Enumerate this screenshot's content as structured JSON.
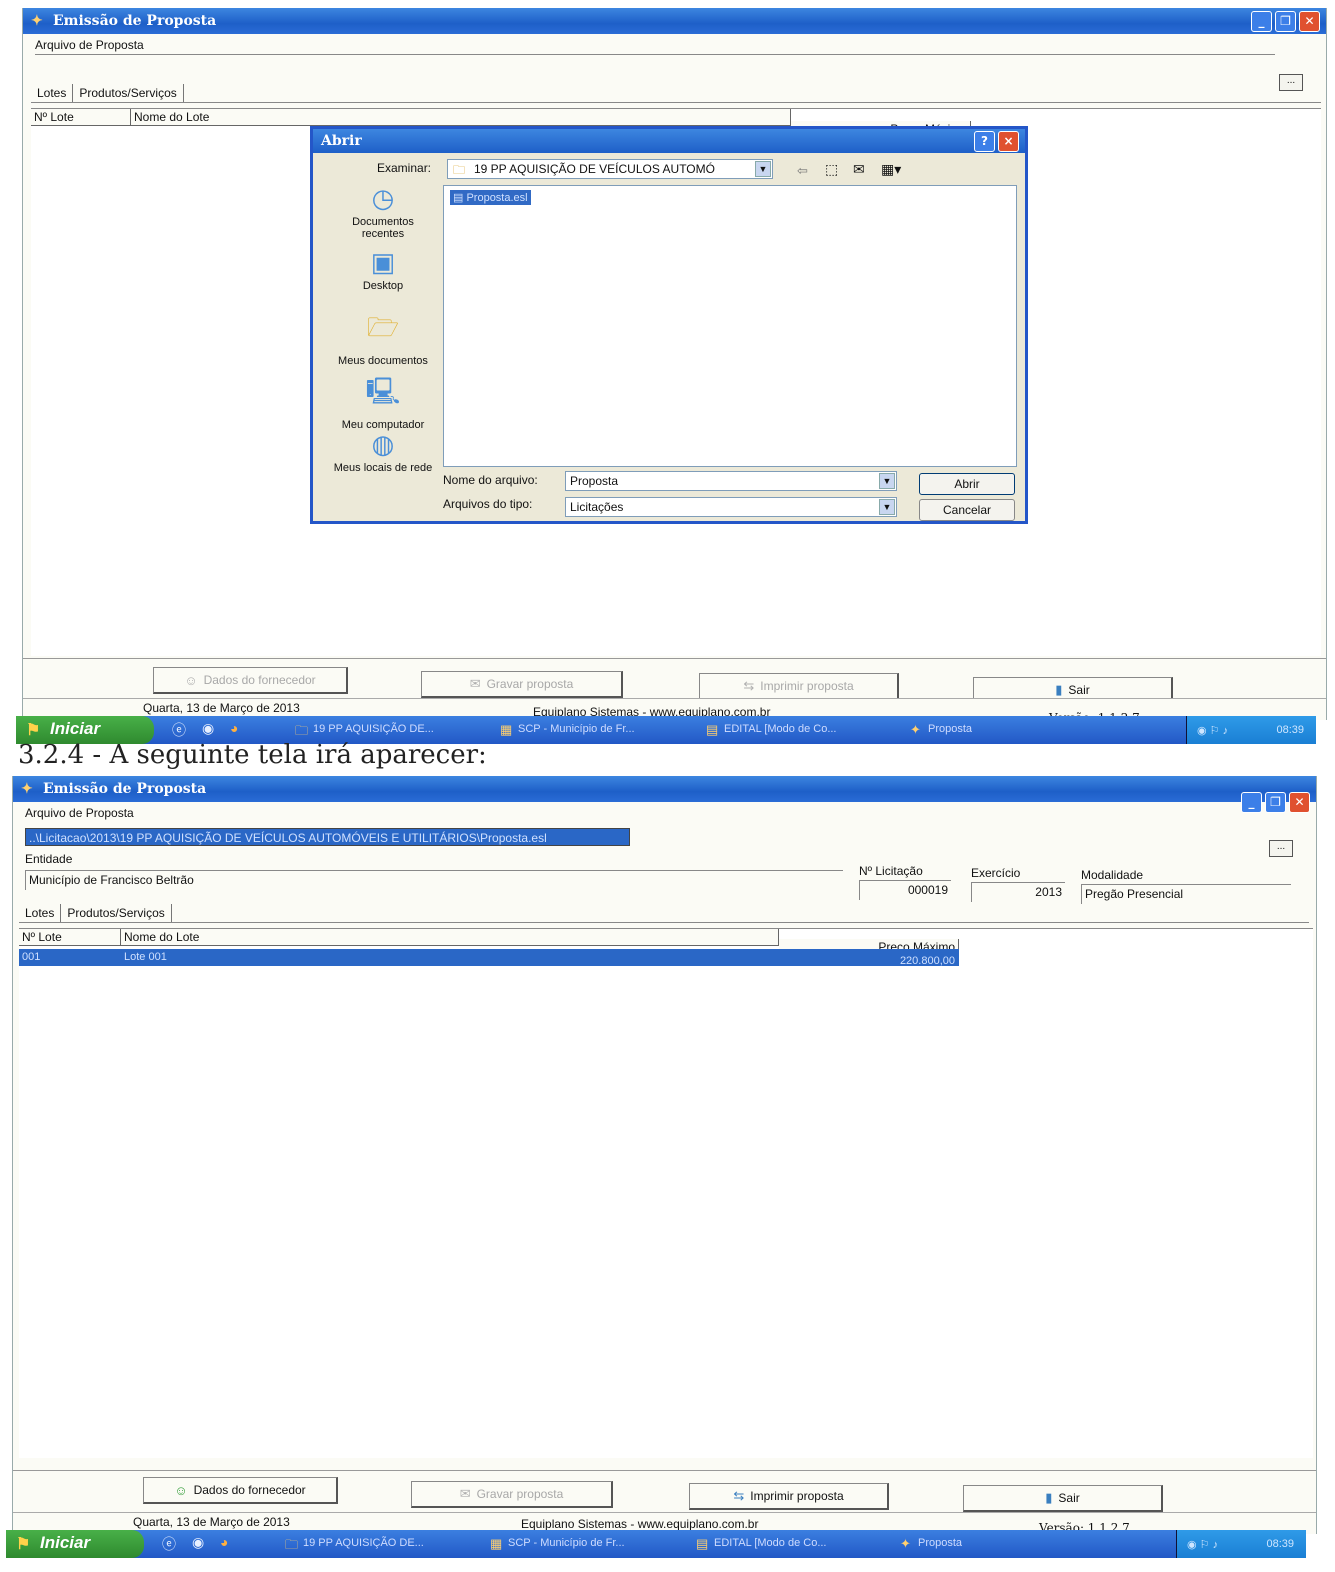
{
  "shot1": {
    "window": {
      "title": "Emissão de Proposta"
    },
    "arquivo": {
      "label": "Arquivo de Proposta",
      "value": "",
      "browse_label": "..."
    },
    "tabs": [
      "Lotes",
      "Produtos/Serviços"
    ],
    "grid": {
      "col_num": "Nº Lote",
      "col_name": "Nome do Lote",
      "col_price": "Preço Máximo"
    },
    "dialog": {
      "title": "Abrir",
      "look_in_label": "Examinar:",
      "look_in_value": "19 PP AQUISIÇÃO DE VEÍCULOS AUTOMÓ",
      "places": [
        "Documentos recentes",
        "Desktop",
        "Meus documentos",
        "Meu computador",
        "Meus locais de rede"
      ],
      "file_item": "Proposta.esl",
      "filename_label": "Nome do arquivo:",
      "filename_value": "Proposta",
      "filetype_label": "Arquivos do tipo:",
      "filetype_value": "Licitações",
      "open_label": "Abrir",
      "cancel_label": "Cancelar",
      "help_label": "?",
      "close_label": "×"
    },
    "buttons": {
      "fornecedor": "Dados do fornecedor",
      "gravar": "Gravar proposta",
      "imprimir": "Imprimir proposta",
      "sair": "Sair"
    },
    "status": {
      "date": "Quarta, 13 de Março de 2013",
      "company": "Equiplano Sistemas - www.equiplano.com.br",
      "version": "Versão: 1.1.2.7"
    },
    "taskbar": {
      "start": "Iniciar",
      "tasks": [
        "19 PP AQUISIÇÃO DE...",
        "SCP - Município de Fr...",
        "EDITAL [Modo de Co...",
        "Proposta"
      ],
      "clock": "08:39"
    }
  },
  "caption": "3.2.4 - A seguinte tela irá aparecer:",
  "shot2": {
    "window": {
      "title": "Emissão de Proposta"
    },
    "arquivo": {
      "label": "Arquivo de Proposta",
      "value": "..\\Licitacao\\2013\\19 PP AQUISIÇÃO DE VEÍCULOS AUTOMÓVEIS E UTILITÁRIOS\\Proposta.esl",
      "browse_label": "..."
    },
    "entidade": {
      "label": "Entidade",
      "value": "Município de Francisco Beltrão"
    },
    "licitacao": {
      "label": "Nº Licitação",
      "value": "000019"
    },
    "exercicio": {
      "label": "Exercício",
      "value": "2013"
    },
    "modalidade": {
      "label": "Modalidade",
      "value": "Pregão Presencial"
    },
    "tabs": [
      "Lotes",
      "Produtos/Serviços"
    ],
    "grid": {
      "col_num": "Nº Lote",
      "col_name": "Nome do Lote",
      "col_price": "Preço Máximo",
      "rows": [
        {
          "num": "001",
          "name": "Lote 001",
          "price": "220.800,00"
        }
      ]
    },
    "buttons": {
      "fornecedor": "Dados do fornecedor",
      "gravar": "Gravar proposta",
      "imprimir": "Imprimir proposta",
      "sair": "Sair"
    },
    "status": {
      "date": "Quarta, 13 de Março de 2013",
      "company": "Equiplano Sistemas - www.equiplano.com.br",
      "version": "Versão: 1.1.2.7"
    },
    "taskbar": {
      "start": "Iniciar",
      "tasks": [
        "19 PP AQUISIÇÃO DE...",
        "SCP - Município de Fr...",
        "EDITAL [Modo de Co...",
        "Proposta"
      ],
      "clock": "08:39"
    }
  },
  "colors": {
    "titlebar": "#1e5fc8",
    "selection": "#2a67c6",
    "start": "#2f8a2f"
  }
}
